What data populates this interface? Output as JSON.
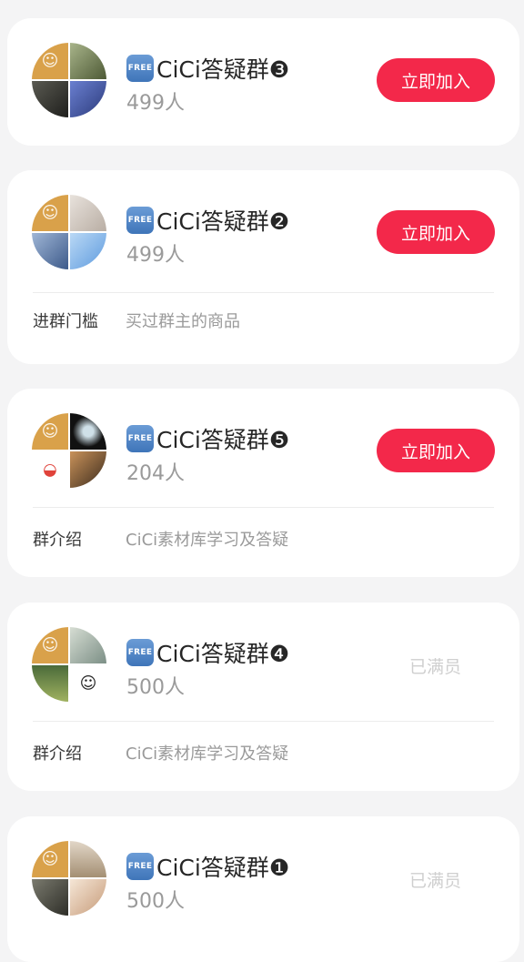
{
  "groups": [
    {
      "badge": "FREE",
      "name": "CiCi答疑群❸",
      "members": "499人",
      "action": "立即加入",
      "status": "join",
      "info_key": "",
      "info_value": "",
      "tiles": [
        "#d9a14a",
        "#8f9d6a",
        "#3b3a35",
        "#4a5fa8"
      ]
    },
    {
      "badge": "FREE",
      "name": "CiCi答疑群❷",
      "members": "499人",
      "action": "立即加入",
      "status": "join",
      "info_key": "进群门槛",
      "info_value": "买过群主的商品",
      "tiles": [
        "#d9a14a",
        "#d8cfc6",
        "#6f8fb8",
        "#7fb2e6"
      ]
    },
    {
      "badge": "FREE",
      "name": "CiCi答疑群❺",
      "members": "204人",
      "action": "立即加入",
      "status": "join",
      "info_key": "群介绍",
      "info_value": "CiCi素材库学习及答疑",
      "tiles": [
        "#d9a14a",
        "#1d1d1d",
        "#ffffff",
        "#9a6a3f"
      ]
    },
    {
      "badge": "FREE",
      "name": "CiCi答疑群❹",
      "members": "500人",
      "action": "已满员",
      "status": "full",
      "info_key": "群介绍",
      "info_value": "CiCi素材库学习及答疑",
      "tiles": [
        "#d9a14a",
        "#b6c3b8",
        "#6f8a4a",
        "#ffffff"
      ]
    },
    {
      "badge": "FREE",
      "name": "CiCi答疑群❶",
      "members": "500人",
      "action": "已满员",
      "status": "full",
      "info_key": "",
      "info_value": "",
      "tiles": [
        "#d9a14a",
        "#c9b9a4",
        "#5b5a52",
        "#efe0d0"
      ]
    }
  ]
}
